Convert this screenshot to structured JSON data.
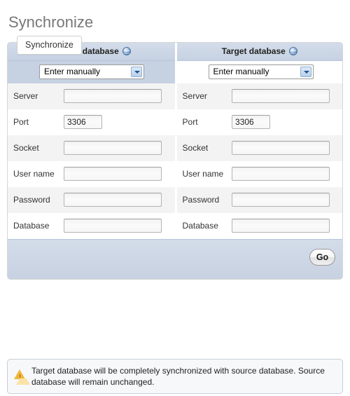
{
  "page": {
    "title": "Synchronize"
  },
  "tab": {
    "label": "Synchronize"
  },
  "table": {
    "headers": [
      {
        "label": "Source database",
        "help_icon": "help-globe-icon"
      },
      {
        "label": "Target database",
        "help_icon": "help-globe-icon"
      }
    ],
    "connection_select": {
      "source": {
        "value": "Enter manually",
        "options": [
          "Enter manually"
        ]
      },
      "target": {
        "value": "Enter manually",
        "options": [
          "Enter manually"
        ]
      }
    },
    "fields": [
      {
        "label": "Server",
        "source": {
          "value": "",
          "placeholder": ""
        },
        "target": {
          "value": "",
          "placeholder": ""
        },
        "size": "normal"
      },
      {
        "label": "Port",
        "source": {
          "value": "3306",
          "placeholder": ""
        },
        "target": {
          "value": "3306",
          "placeholder": ""
        },
        "size": "short"
      },
      {
        "label": "Socket",
        "source": {
          "value": "",
          "placeholder": ""
        },
        "target": {
          "value": "",
          "placeholder": ""
        },
        "size": "normal"
      },
      {
        "label": "User name",
        "source": {
          "value": "",
          "placeholder": ""
        },
        "target": {
          "value": "",
          "placeholder": ""
        },
        "size": "normal"
      },
      {
        "label": "Password",
        "source": {
          "value": "",
          "placeholder": ""
        },
        "target": {
          "value": "",
          "placeholder": ""
        },
        "size": "normal"
      },
      {
        "label": "Database",
        "source": {
          "value": "",
          "placeholder": ""
        },
        "target": {
          "value": "",
          "placeholder": ""
        },
        "size": "normal"
      }
    ]
  },
  "actions": {
    "go_label": "Go"
  },
  "notice": {
    "icon": "warning-triangle-icon",
    "text": "Target database will be completely synchronized with source database. Source database will remain unchanged."
  },
  "colors": {
    "header_band": "#c6d2e2",
    "accent_blue": "#5a81b3",
    "warning": "#f0b63c",
    "title_grey": "#777777",
    "row_alt": "#f3f3f3"
  }
}
